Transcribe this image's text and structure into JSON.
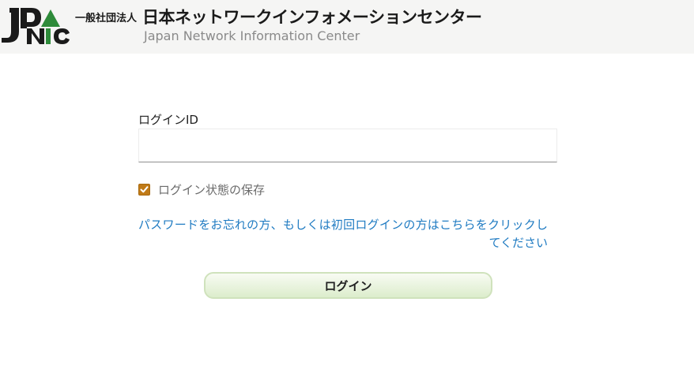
{
  "header": {
    "logo_text": "JPNIC",
    "org_prefix": "一般社団法人",
    "org_name_ja": "日本ネットワークインフォメーションセンター",
    "org_name_en": "Japan Network Information Center"
  },
  "form": {
    "id_label": "ログインID",
    "id_value": "",
    "remember_label": "ログイン状態の保存",
    "remember_checked": true,
    "forgot_link": "パスワードをお忘れの方、もしくは初回ログインの方はこちらをクリックしてください",
    "login_button": "ログイン"
  },
  "colors": {
    "header_bg": "#f5f5f4",
    "link": "#1f7bc2",
    "checkbox": "#c07a17",
    "button_bg": "#dcedcc",
    "logo_green": "#2e8b3a"
  }
}
